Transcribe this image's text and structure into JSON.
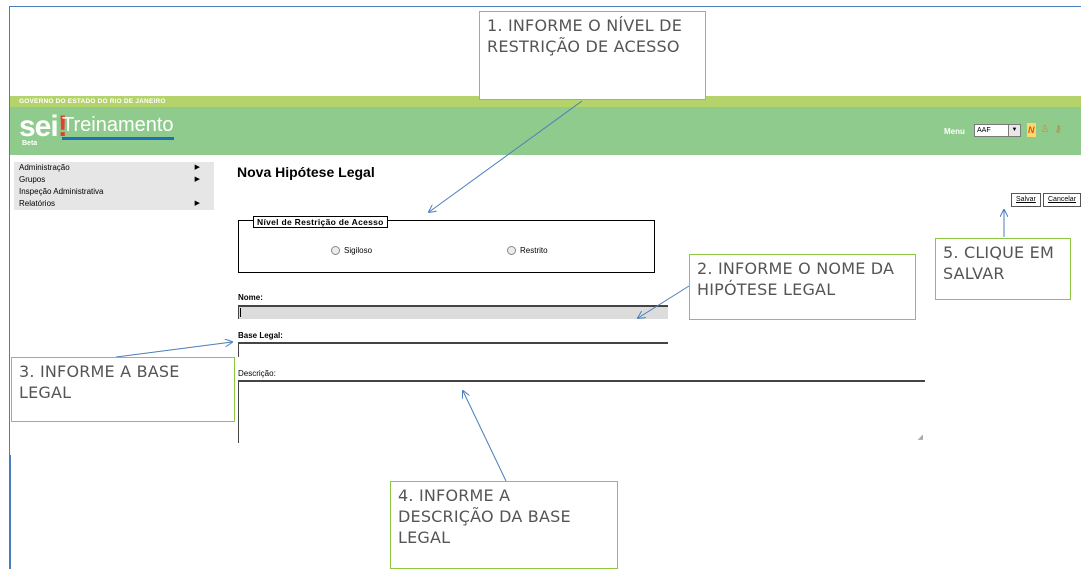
{
  "header": {
    "gov_text": "GOVERNO DO ESTADO DO RIO DE JANEIRO",
    "logo": "sei",
    "app_title": "Treinamento",
    "beta": "Beta",
    "menu_label": "Menu",
    "unit_value": "AAF",
    "icons": [
      "new-icon",
      "user-icon",
      "key-icon"
    ]
  },
  "sidebar": {
    "items": [
      {
        "label": "Administração",
        "has_submenu": true
      },
      {
        "label": "Grupos",
        "has_submenu": true
      },
      {
        "label": "Inspeção Administrativa",
        "has_submenu": false
      },
      {
        "label": "Relatórios",
        "has_submenu": true
      }
    ]
  },
  "form": {
    "title": "Nova Hipótese Legal",
    "save_button": "Salvar",
    "cancel_button": "Cancelar",
    "fieldset_legend": "Nível de Restrição de Acesso",
    "radio_sigiloso": "Sigiloso",
    "radio_restrito": "Restrito",
    "nome_label": "Nome:",
    "nome_value": "",
    "base_label": "Base Legal:",
    "base_value": "",
    "descricao_label": "Descrição:",
    "descricao_value": ""
  },
  "callouts": {
    "c1": "1. INFORME O NÍVEL DE RESTRIÇÃO DE ACESSO",
    "c2": "2. INFORME O NOME DA HIPÓTESE LEGAL",
    "c3": "3. INFORME A BASE LEGAL",
    "c4": "4. INFORME A DESCRIÇÃO DA BASE LEGAL",
    "c5": "5. CLIQUE EM SALVAR"
  },
  "colors": {
    "header_green": "#8fcb8d",
    "gov_bar": "#b5d36b",
    "callout_border": "#8dc63f",
    "arrow": "#4a7ebb"
  }
}
